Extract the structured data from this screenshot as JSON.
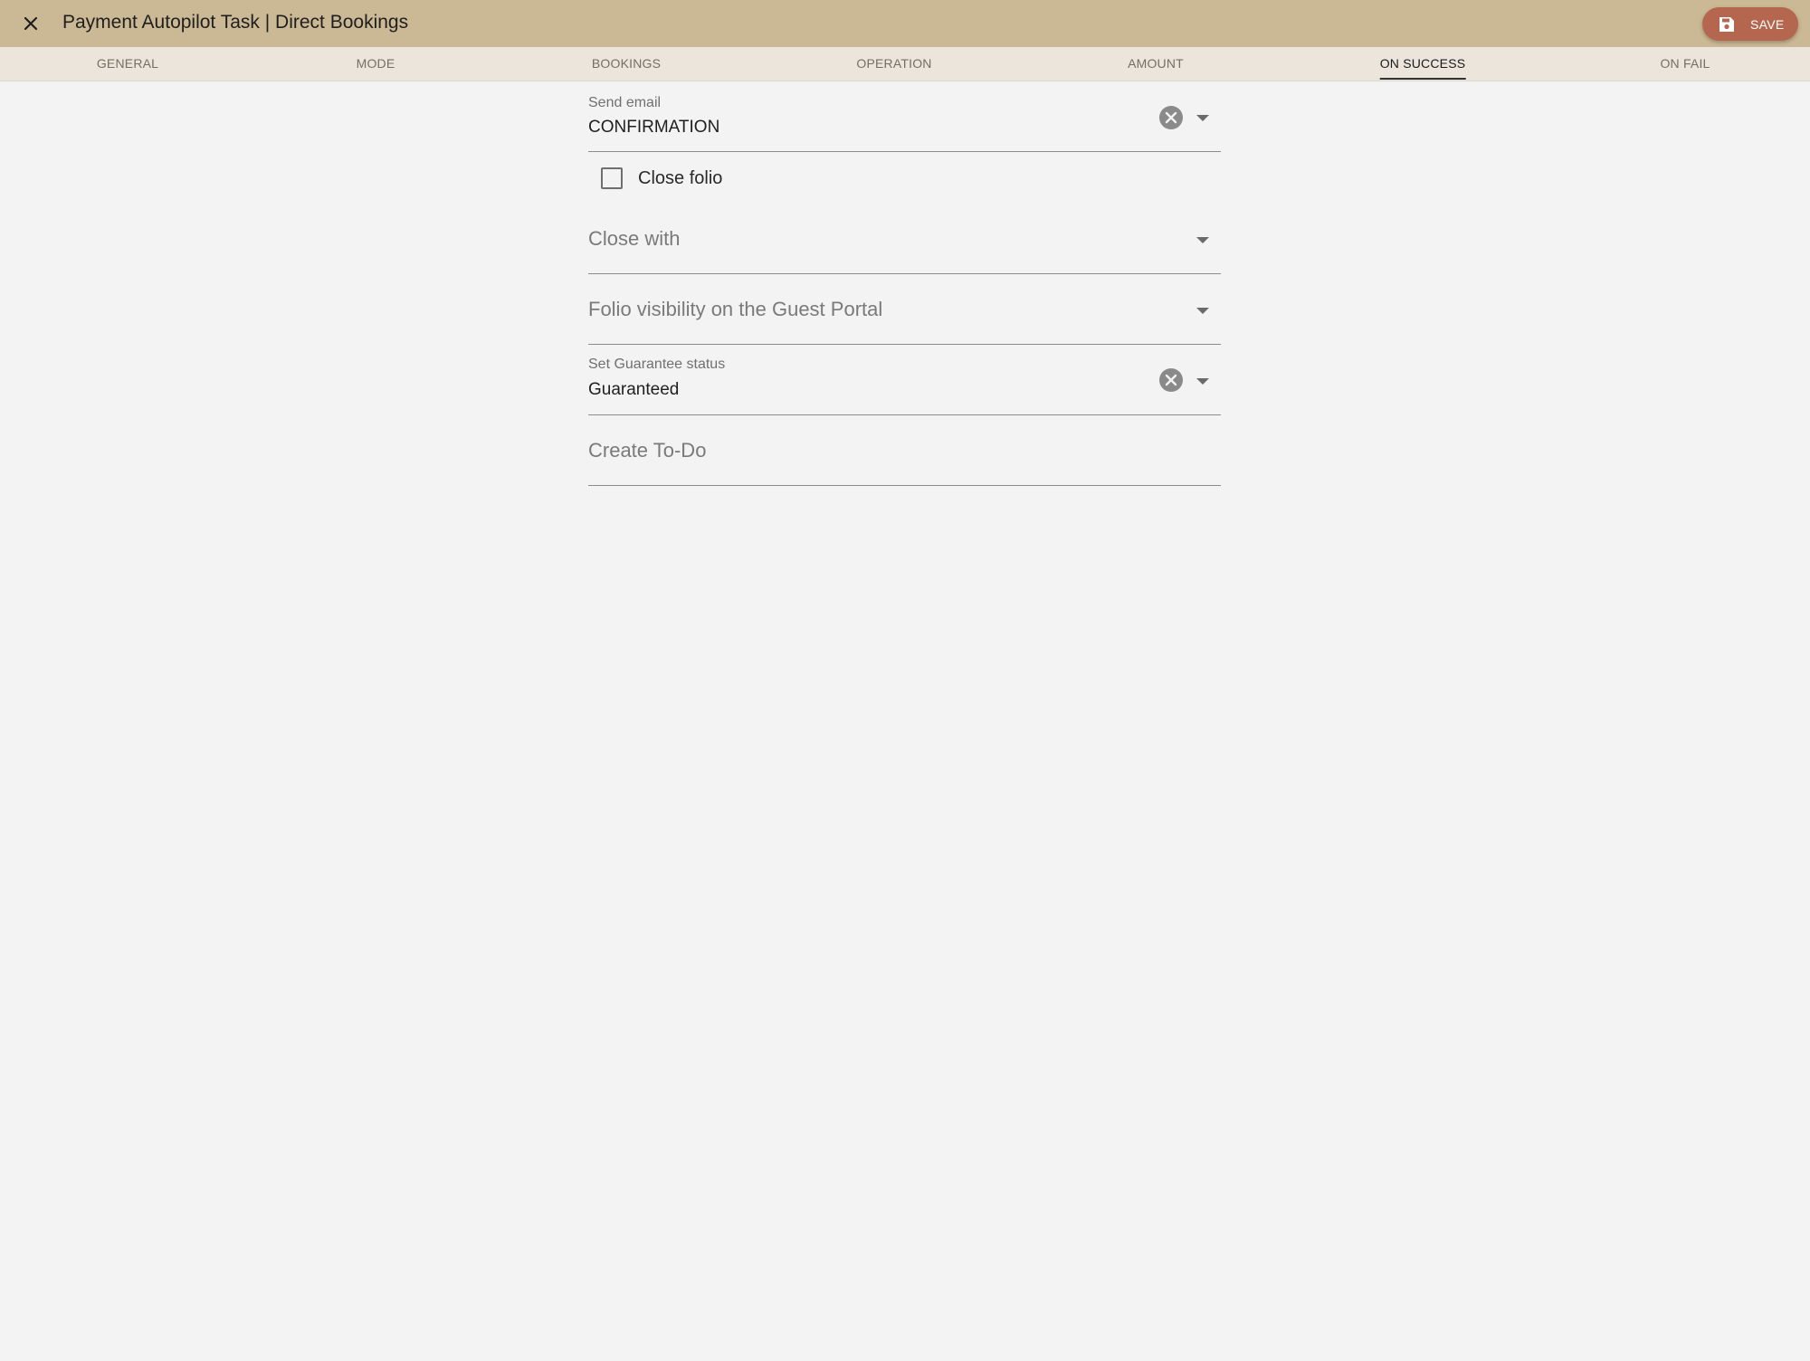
{
  "header": {
    "title": "Payment Autopilot Task | Direct Bookings",
    "close_icon": "close-icon",
    "save_label": "SAVE",
    "save_icon": "save-icon",
    "colors": {
      "app_bar": "#cbb894",
      "save_button": "#b5664f",
      "tab_bar": "#ebe5db"
    }
  },
  "tabs": [
    {
      "label": "GENERAL",
      "active": false
    },
    {
      "label": "MODE",
      "active": false
    },
    {
      "label": "BOOKINGS",
      "active": false
    },
    {
      "label": "OPERATION",
      "active": false
    },
    {
      "label": "AMOUNT",
      "active": false
    },
    {
      "label": "ON SUCCESS",
      "active": true
    },
    {
      "label": "ON FAIL",
      "active": false
    }
  ],
  "form": {
    "send_email": {
      "label": "Send email",
      "value": "CONFIRMATION"
    },
    "close_folio": {
      "label": "Close folio",
      "checked": false
    },
    "close_with": {
      "placeholder": "Close with"
    },
    "folio_visibility": {
      "placeholder": "Folio visibility on the Guest Portal"
    },
    "guarantee_status": {
      "label": "Set Guarantee status",
      "value": "Guaranteed"
    },
    "create_todo": {
      "placeholder": "Create To-Do"
    }
  }
}
